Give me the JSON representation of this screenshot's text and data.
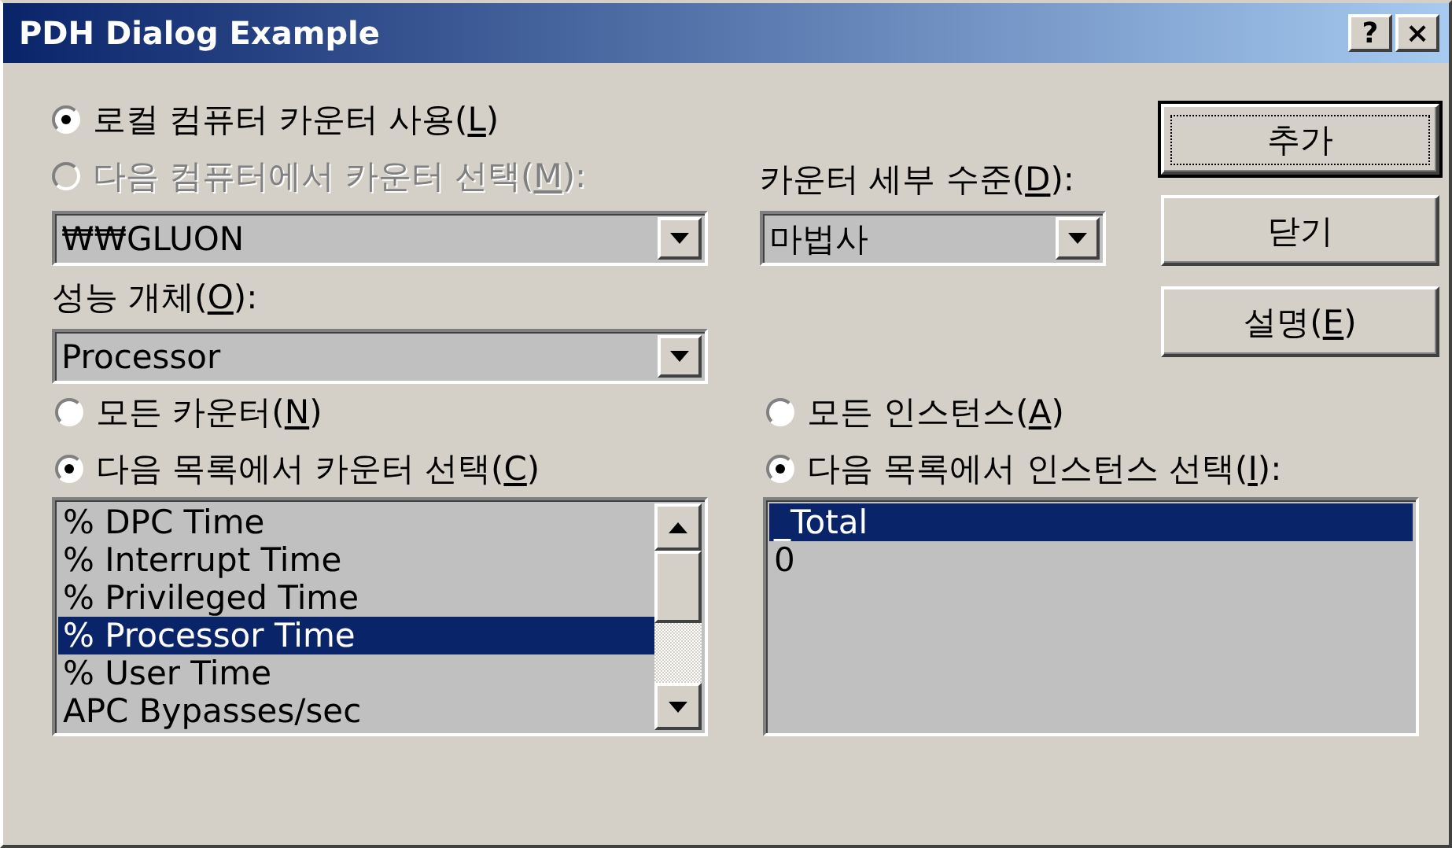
{
  "window": {
    "title": "PDH Dialog Example",
    "help_button": "?",
    "close_button": "×"
  },
  "computer_mode": [
    {
      "label": "로컬 컴퓨터 카운터 사용(",
      "access_key": "L",
      "label_end": ")",
      "selected": true,
      "disabled": false
    },
    {
      "label": "다음 컴퓨터에서 카운터 선택(",
      "access_key": "M",
      "label_end": "):",
      "selected": false,
      "disabled": true
    }
  ],
  "computer_combo": {
    "value": "₩₩GLUON"
  },
  "detail_level": {
    "label": "카운터 세부 수준(",
    "access_key": "D",
    "label_end": "):",
    "value": "마법사"
  },
  "performance_object": {
    "label": "성능 개체(",
    "access_key": "O",
    "label_end": "):",
    "value": "Processor"
  },
  "buttons": [
    {
      "label": "추가",
      "default": true
    },
    {
      "label": "닫기",
      "default": false
    },
    {
      "label": "설명(",
      "access_key": "E",
      "label_end": ")",
      "default": false
    }
  ],
  "counter_mode": [
    {
      "label": "모든 카운터(",
      "access_key": "N",
      "label_end": ")",
      "selected": false
    },
    {
      "label": "다음 목록에서 카운터 선택(",
      "access_key": "C",
      "label_end": ")",
      "selected": true
    }
  ],
  "instance_mode": [
    {
      "label": "모든 인스턴스(",
      "access_key": "A",
      "label_end": ")",
      "selected": false
    },
    {
      "label": "다음 목록에서 인스턴스 선택(",
      "access_key": "I",
      "label_end": "):",
      "selected": true
    }
  ],
  "counters": [
    {
      "text": "% DPC Time",
      "selected": false
    },
    {
      "text": "% Interrupt Time",
      "selected": false
    },
    {
      "text": "% Privileged Time",
      "selected": false
    },
    {
      "text": "% Processor Time",
      "selected": true
    },
    {
      "text": "% User Time",
      "selected": false
    },
    {
      "text": "APC Bypasses/sec",
      "selected": false
    }
  ],
  "instances": [
    {
      "text": "_Total",
      "selected": true
    },
    {
      "text": "0",
      "selected": false
    }
  ]
}
